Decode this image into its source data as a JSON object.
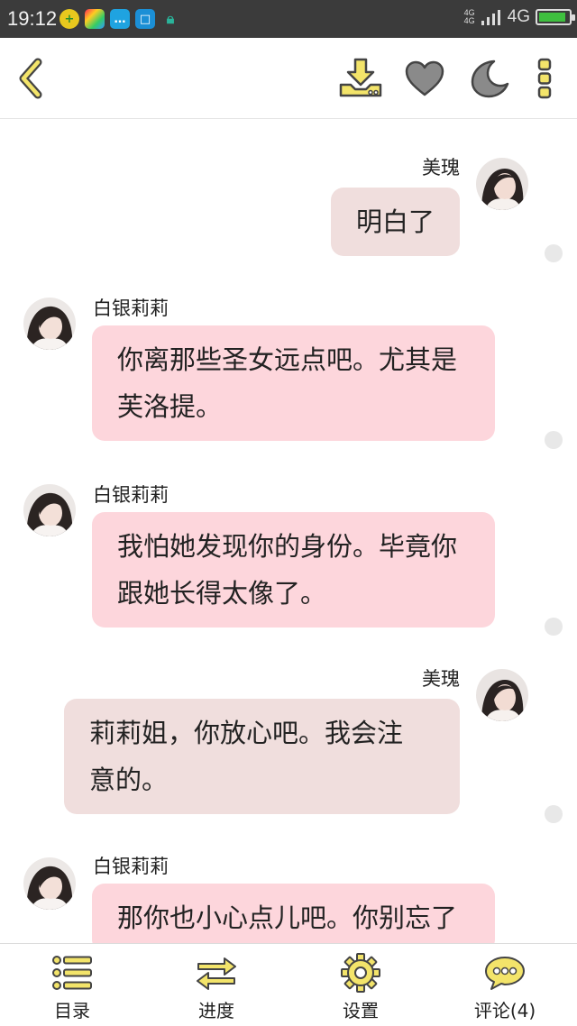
{
  "status_bar": {
    "time": "19:12",
    "network_small_top": "4G",
    "network_small_bottom": "4G",
    "network_label": "4G",
    "battery_level_percent": 90
  },
  "toolbar": {
    "back_icon": "chevron-left-icon",
    "download_icon": "download-icon",
    "favorite_icon": "heart-icon",
    "night_mode_icon": "moon-icon",
    "more_icon": "more-vertical-icon"
  },
  "messages": [
    {
      "side": "right",
      "sender": "美瑰",
      "lines": [
        "明白了"
      ]
    },
    {
      "side": "left",
      "sender": "白银莉莉",
      "lines": [
        "你离那些圣女远点吧。尤其是",
        "芙洛提。"
      ]
    },
    {
      "side": "left",
      "sender": "白银莉莉",
      "lines": [
        "我怕她发现你的身份。毕竟你",
        "跟她长得太像了。"
      ]
    },
    {
      "side": "right",
      "sender": "美瑰",
      "lines": [
        "莉莉姐，你放心吧。我会注",
        "意的。"
      ]
    },
    {
      "side": "left",
      "sender": "白银莉莉",
      "lines": [
        "那你也小心点儿吧。你别忘了"
      ]
    }
  ],
  "bottom_tabs": [
    {
      "label": "目录",
      "icon": "list-icon"
    },
    {
      "label": "进度",
      "icon": "swap-arrows-icon"
    },
    {
      "label": "设置",
      "icon": "gear-icon"
    },
    {
      "label": "评论(4)",
      "icon": "comment-icon"
    }
  ],
  "colors": {
    "accent_yellow": "#f3e46a",
    "icon_outline": "#444444",
    "bubble_left": "#fdd6dc",
    "bubble_right": "#f0dedd"
  }
}
